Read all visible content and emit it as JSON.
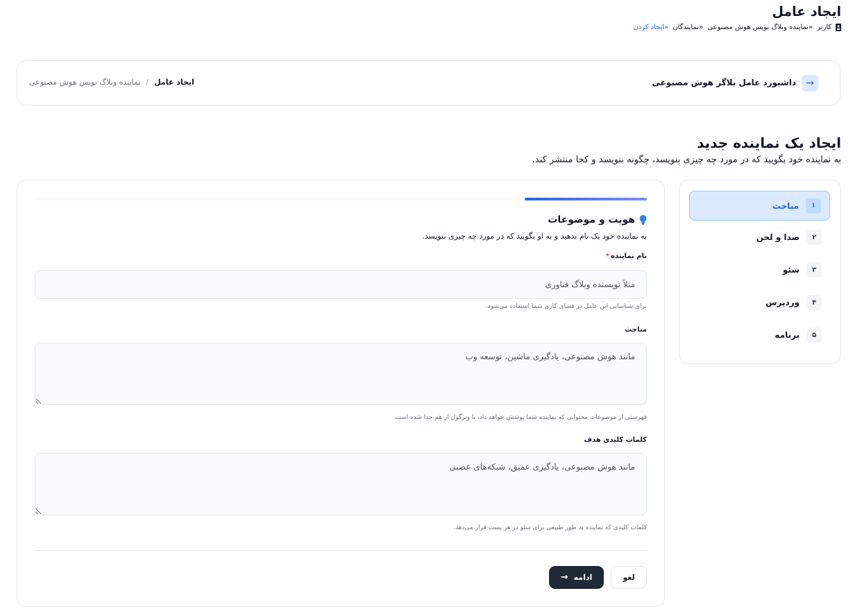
{
  "header": {
    "title": "ایجاد عامل",
    "breadcrumb": {
      "user": "کاربر",
      "agent": "«نماینده وبلاگ نویس هوش مصنوعی",
      "agents": "«نمایندگان",
      "create": "«ایجاد کردن"
    }
  },
  "topbar": {
    "back_icon": "arrow-right-icon",
    "dashboard_title": "داشبورد عامل بلاگر هوش مصنوعی",
    "breadcrumb_current": "ایجاد عامل",
    "breadcrumb_separator": "/",
    "breadcrumb_prev": "نماینده وبلاگ نویس هوش مصنوعی"
  },
  "page": {
    "heading": "ایجاد یک نماینده جدید",
    "subheading": "به نماینده خود بگویید که در مورد چه چیزی بنویسد، چگونه بنویسد و کجا منتشر کند."
  },
  "steps": [
    {
      "num": "۱",
      "label": "مباحث",
      "active": true
    },
    {
      "num": "۲",
      "label": "صدا و لحن",
      "active": false
    },
    {
      "num": "۳",
      "label": "سئو",
      "active": false
    },
    {
      "num": "۴",
      "label": "وردپرس",
      "active": false
    },
    {
      "num": "۵",
      "label": "برنامه",
      "active": false
    }
  ],
  "form": {
    "progress": 0.2,
    "section_icon": "lightbulb-icon",
    "section_title": "هویت و موضوعات",
    "section_desc": "به نماینده خود یک نام بدهید و به او بگویید که در مورد چه چیزی بنویسد.",
    "name": {
      "label": "نام نماینده",
      "required_mark": "*",
      "placeholder": "مثلاً نویسنده وبلاگ فناوری",
      "value": "",
      "help": "برای شناسایی این عامل در فضای کاری شما استفاده می‌شود."
    },
    "topics": {
      "label": "مباحث",
      "placeholder": "مانند هوش مصنوعی، یادگیری ماشین، توسعه وب",
      "value": "",
      "help": "فهرستی از موضوعات محتوایی که نماینده شما پوشش خواهد داد، با ویرگول از هم جدا شده است."
    },
    "keywords": {
      "label": "کلمات کلیدی هدف",
      "placeholder": "مانند هوش مصنوعی، یادگیری عمیق، شبکه‌های عصبی",
      "value": "",
      "help": "کلمات کلیدی که نماینده به طور طبیعی برای سئو در هر پست قرار می‌دهد."
    },
    "cancel_label": "لغو",
    "next_label": "ادامه",
    "next_icon": "arrow-right-icon"
  },
  "colors": {
    "accent": "#2563eb",
    "primary_button": "#1f2937",
    "active_step_bg": "#dbeafe",
    "required": "#ef4444"
  }
}
